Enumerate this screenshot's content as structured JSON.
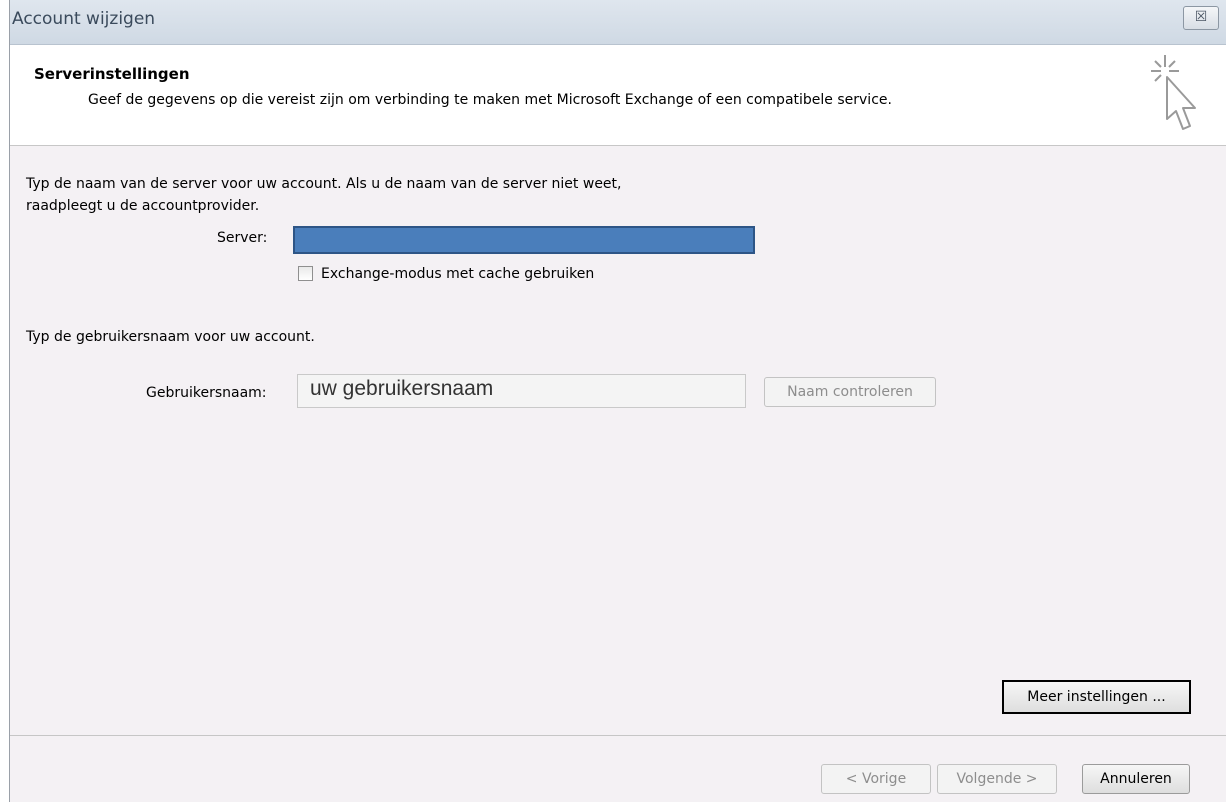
{
  "window": {
    "title": "Account wijzigen",
    "close_symbol": "☒"
  },
  "header": {
    "title": "Serverinstellingen",
    "description": "Geef de gegevens op die vereist zijn om verbinding te maken met Microsoft Exchange of een compatibele service.",
    "icon": "cursor-sparkle-icon"
  },
  "server_section": {
    "instruction_line1": "Typ de naam van de server voor uw account. Als u de naam van de server niet weet,",
    "instruction_line2": "raadpleegt u de accountprovider.",
    "server_label": "Server:",
    "server_value": "",
    "cache_checkbox_label": "Exchange-modus met cache gebruiken",
    "cache_checked": false
  },
  "user_section": {
    "instruction": "Typ de gebruikersnaam voor uw account.",
    "username_label": "Gebruikersnaam:",
    "username_value": "uw gebruikersnaam",
    "check_name_button": "Naam controleren"
  },
  "buttons": {
    "more_settings": "Meer instellingen ...",
    "back": "< Vorige",
    "next": "Volgende >",
    "cancel": "Annuleren"
  },
  "colors": {
    "server_field_fill": "#4a7ebb",
    "window_background": "#f4f1f4"
  }
}
